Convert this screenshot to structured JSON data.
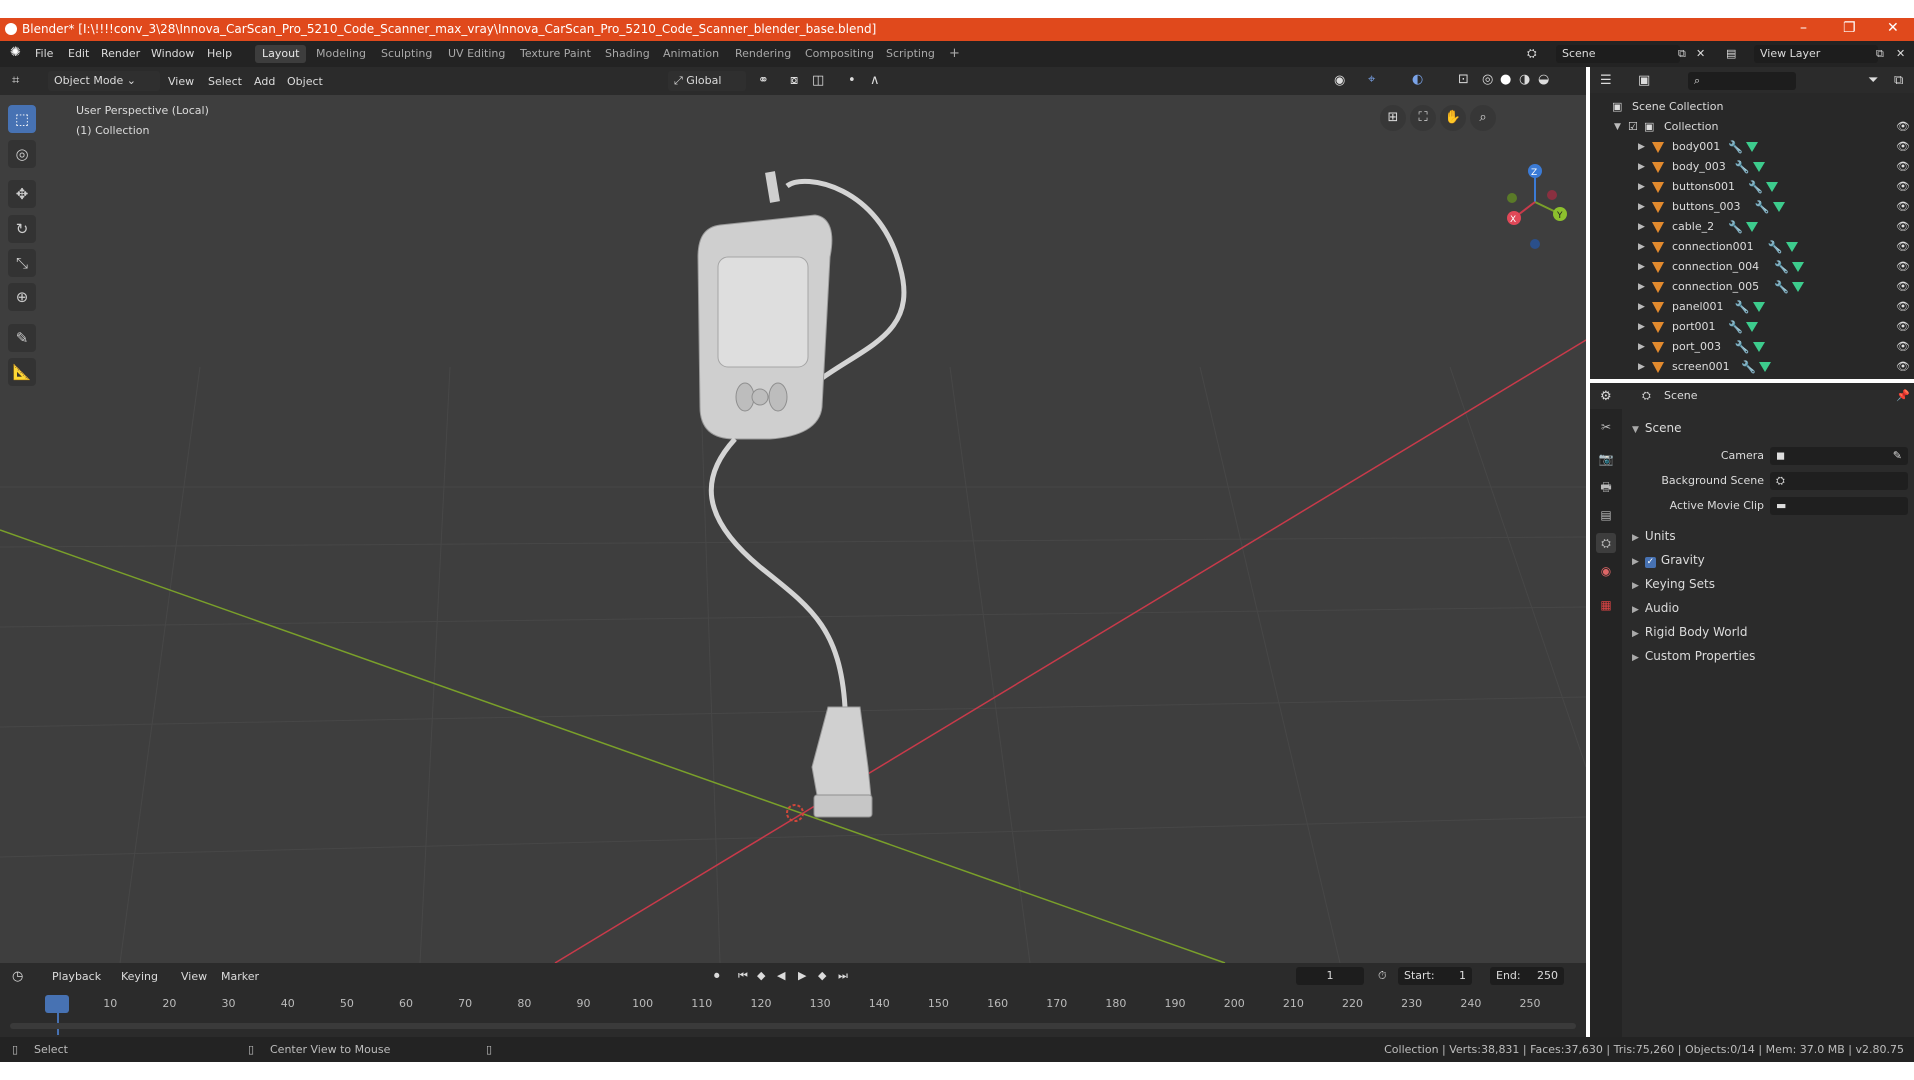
{
  "window": {
    "title": "Blender* [I:\\!!!!conv_3\\28\\Innova_CarScan_Pro_5210_Code_Scanner_max_vray\\Innova_CarScan_Pro_5210_Code_Scanner_blender_base.blend]",
    "minimize": "–",
    "maximize": "❐",
    "close": "✕"
  },
  "menu": {
    "file": "File",
    "edit": "Edit",
    "render": "Render",
    "window": "Window",
    "help": "Help",
    "workspaces": [
      "Layout",
      "Modeling",
      "Sculpting",
      "UV Editing",
      "Texture Paint",
      "Shading",
      "Animation",
      "Rendering",
      "Compositing",
      "Scripting"
    ],
    "add_workspace": "+",
    "scene": "Scene",
    "view_layer": "View Layer"
  },
  "viewport": {
    "mode": "Object Mode",
    "view": "View",
    "select": "Select",
    "add": "Add",
    "object": "Object",
    "orientation": "Global",
    "perspective": "User Perspective (Local)",
    "collection": "(1) Collection",
    "gizmo": {
      "x": "X",
      "y": "Y",
      "z": "Z"
    }
  },
  "outliner": {
    "search_placeholder": "",
    "scene_collection": "Scene Collection",
    "collection": "Collection",
    "objects": [
      "body001",
      "body_003",
      "buttons001",
      "buttons_003",
      "cable_2",
      "connection001",
      "connection_004",
      "connection_005",
      "panel001",
      "port001",
      "port_003",
      "screen001"
    ]
  },
  "properties": {
    "header": "Scene",
    "section": "Scene",
    "camera_label": "Camera",
    "background_scene_label": "Background Scene",
    "active_movie_clip_label": "Active Movie Clip",
    "units": "Units",
    "gravity": "Gravity",
    "keying_sets": "Keying Sets",
    "audio": "Audio",
    "rigid_body_world": "Rigid Body World",
    "custom_properties": "Custom Properties"
  },
  "timeline": {
    "playback": "Playback",
    "keying": "Keying",
    "view": "View",
    "marker": "Marker",
    "current_frame": "1",
    "start_label": "Start:",
    "start": "1",
    "end_label": "End:",
    "end": "250",
    "ticks": [
      "1",
      "10",
      "20",
      "30",
      "40",
      "50",
      "60",
      "70",
      "80",
      "90",
      "100",
      "110",
      "120",
      "130",
      "140",
      "150",
      "160",
      "170",
      "180",
      "190",
      "200",
      "210",
      "220",
      "230",
      "240",
      "250"
    ]
  },
  "status": {
    "select": "Select",
    "center_view": "Center View to Mouse",
    "stats": "Collection | Verts:38,831 | Faces:37,630 | Tris:75,260 | Objects:0/14 | Mem: 37.0 MB | v2.80.75"
  },
  "colors": {
    "accent": "#4772b3",
    "title_bar": "#e0491c",
    "mesh_icon": "#e28a2e",
    "x_axis": "#c83a4a",
    "y_axis": "#7aa02a"
  }
}
